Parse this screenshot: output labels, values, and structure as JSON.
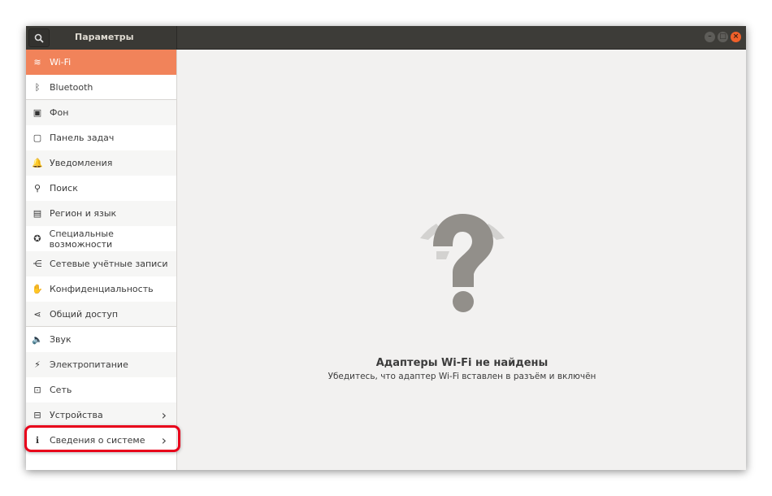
{
  "window": {
    "title": "Параметры",
    "controls": [
      "minimize",
      "maximize",
      "close"
    ]
  },
  "sidebar": {
    "items": [
      {
        "label": "Wi-Fi",
        "icon": "wifi-icon",
        "glyph": "≋",
        "selected": true
      },
      {
        "label": "Bluetooth",
        "icon": "bluetooth-icon",
        "glyph": "ᛒ"
      },
      {
        "label": "Фон",
        "icon": "background-icon",
        "glyph": "▣"
      },
      {
        "label": "Панель задач",
        "icon": "dock-icon",
        "glyph": "▢"
      },
      {
        "label": "Уведомления",
        "icon": "bell-icon",
        "glyph": "🔔"
      },
      {
        "label": "Поиск",
        "icon": "search-icon",
        "glyph": "⚲"
      },
      {
        "label": "Регион и язык",
        "icon": "region-icon",
        "glyph": "▤"
      },
      {
        "label": "Специальные возможности",
        "icon": "accessibility-icon",
        "glyph": "✪"
      },
      {
        "label": "Сетевые учётные записи",
        "icon": "online-accounts-icon",
        "glyph": "⋲"
      },
      {
        "label": "Конфиденциальность",
        "icon": "privacy-hand-icon",
        "glyph": "✋"
      },
      {
        "label": "Общий доступ",
        "icon": "share-icon",
        "glyph": "⋖"
      },
      {
        "label": "Звук",
        "icon": "speaker-icon",
        "glyph": "🔈"
      },
      {
        "label": "Электропитание",
        "icon": "power-icon",
        "glyph": "⚡"
      },
      {
        "label": "Сеть",
        "icon": "network-icon",
        "glyph": "⊡"
      },
      {
        "label": "Устройства",
        "icon": "devices-icon",
        "glyph": "⊟",
        "chevron": true
      },
      {
        "label": "Сведения о системе",
        "icon": "info-icon",
        "glyph": "ℹ",
        "chevron": true,
        "highlighted": true
      }
    ]
  },
  "main": {
    "title": "Адаптеры Wi-Fi не найдены",
    "subtitle": "Убедитесь, что адаптер Wi-Fi вставлен в разъём и включён"
  },
  "colors": {
    "accent": "#f1835a",
    "header": "#3d3c38",
    "highlight": "#e8001a",
    "close": "#f0602a"
  }
}
